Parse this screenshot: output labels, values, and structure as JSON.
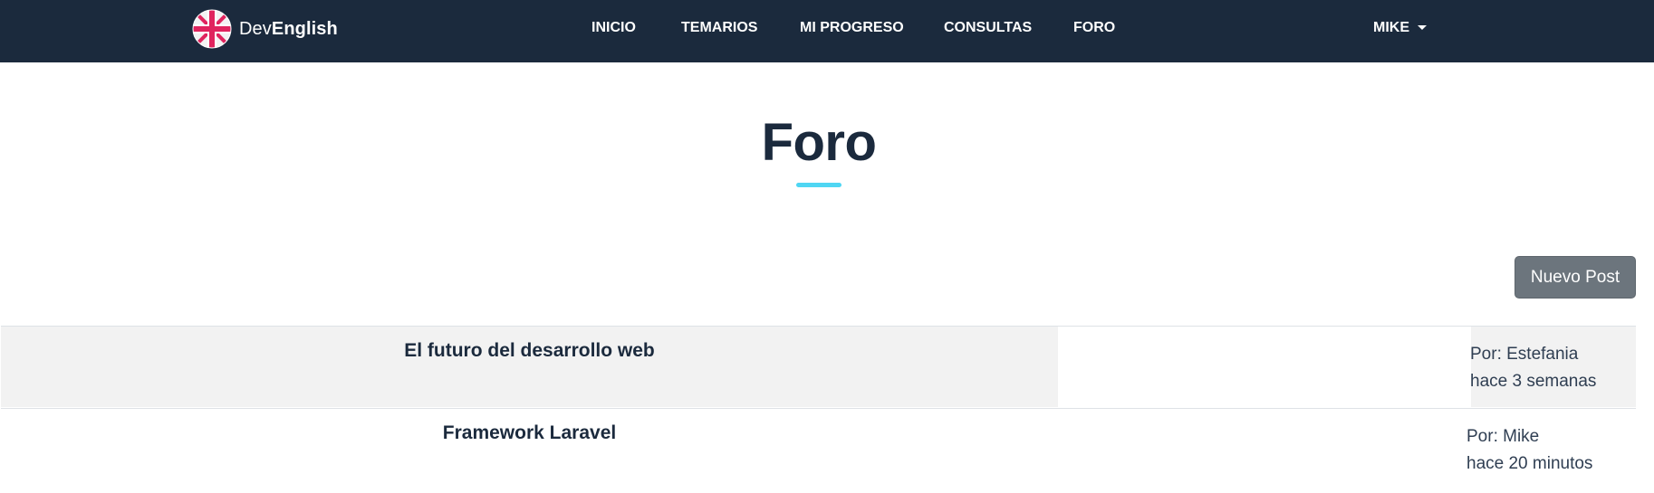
{
  "brand": {
    "text_light": "Dev",
    "text_bold": "English",
    "logo_icon": "uk-flag-icon"
  },
  "nav": {
    "items": [
      {
        "label": "INICIO"
      },
      {
        "label": "TEMARIOS"
      },
      {
        "label": "MI PROGRESO"
      },
      {
        "label": "CONSULTAS"
      },
      {
        "label": "FORO"
      }
    ],
    "user": {
      "label": "MIKE",
      "icon": "caret-down-icon"
    }
  },
  "page": {
    "title": "Foro"
  },
  "actions": {
    "new_post_label": "Nuevo Post"
  },
  "posts": [
    {
      "title": "El futuro del desarrollo web",
      "author": "Por: Estefania",
      "time": "hace 3 semanas"
    },
    {
      "title": "Framework Laravel",
      "author": "Por: Mike",
      "time": "hace 20 minutos"
    }
  ],
  "colors": {
    "navbar": "#1b2a3d",
    "title_accent": "#4fd6f3",
    "button": "#6c757d",
    "row_shade": "#f2f2f2"
  }
}
